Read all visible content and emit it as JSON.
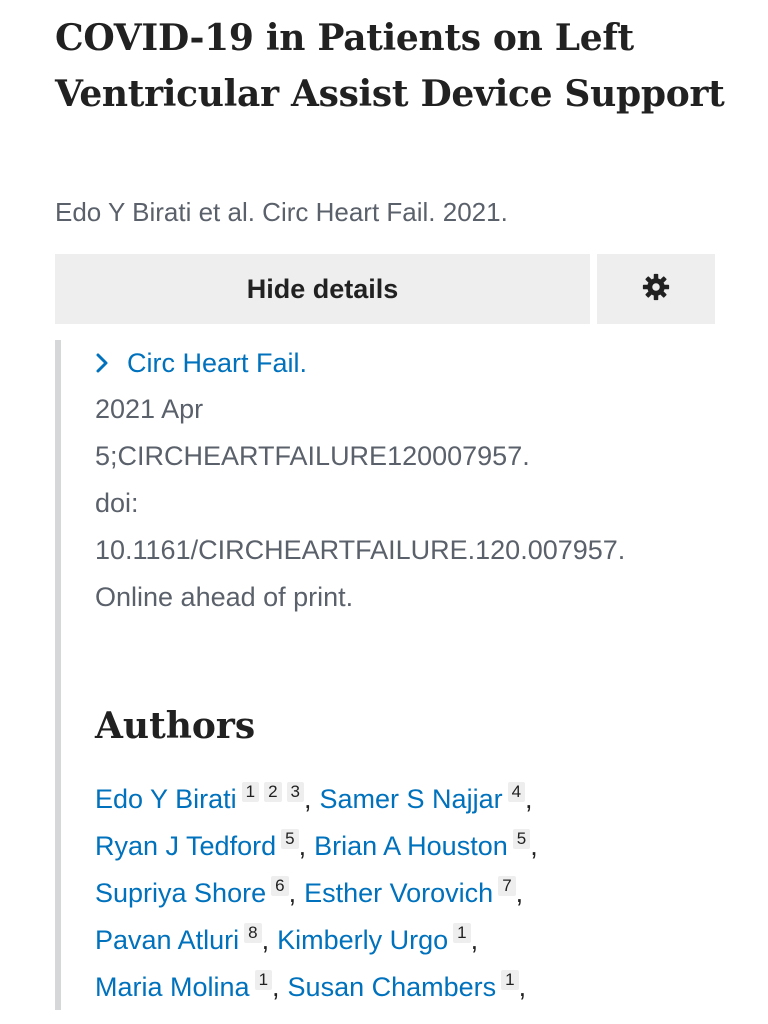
{
  "article": {
    "title": "COVID-19 in Patients on Left Ventricular Assist Device Support",
    "citation": "Edo Y Birati et al. Circ Heart Fail. 2021."
  },
  "toolbar": {
    "hide_details_label": "Hide details",
    "settings_icon": "gear-icon"
  },
  "details": {
    "journal": "Circ Heart Fail.",
    "lines": [
      "2021 Apr",
      "5;CIRCHEARTFAILURE120007957.",
      "doi:",
      "10.1161/CIRCHEARTFAILURE.120.007957.",
      "Online ahead of print."
    ]
  },
  "authors": {
    "heading": "Authors",
    "rows": [
      [
        {
          "name": "Edo Y Birati",
          "affiliations": [
            "1",
            "2",
            "3"
          ]
        },
        {
          "name": "Samer S Najjar",
          "affiliations": [
            "4"
          ]
        }
      ],
      [
        {
          "name": "Ryan J Tedford",
          "affiliations": [
            "5"
          ]
        },
        {
          "name": "Brian A Houston",
          "affiliations": [
            "5"
          ]
        }
      ],
      [
        {
          "name": "Supriya Shore",
          "affiliations": [
            "6"
          ]
        },
        {
          "name": "Esther Vorovich",
          "affiliations": [
            "7"
          ]
        }
      ],
      [
        {
          "name": "Pavan Atluri",
          "affiliations": [
            "8"
          ]
        },
        {
          "name": "Kimberly Urgo",
          "affiliations": [
            "1"
          ]
        }
      ],
      [
        {
          "name": "Maria Molina",
          "affiliations": [
            "1"
          ]
        },
        {
          "name": "Susan Chambers",
          "affiliations": [
            "1"
          ]
        }
      ]
    ]
  },
  "colors": {
    "link": "#0071bc",
    "muted": "#5b616b",
    "button_bg": "#eeeeee",
    "border": "#d6d7d9"
  }
}
